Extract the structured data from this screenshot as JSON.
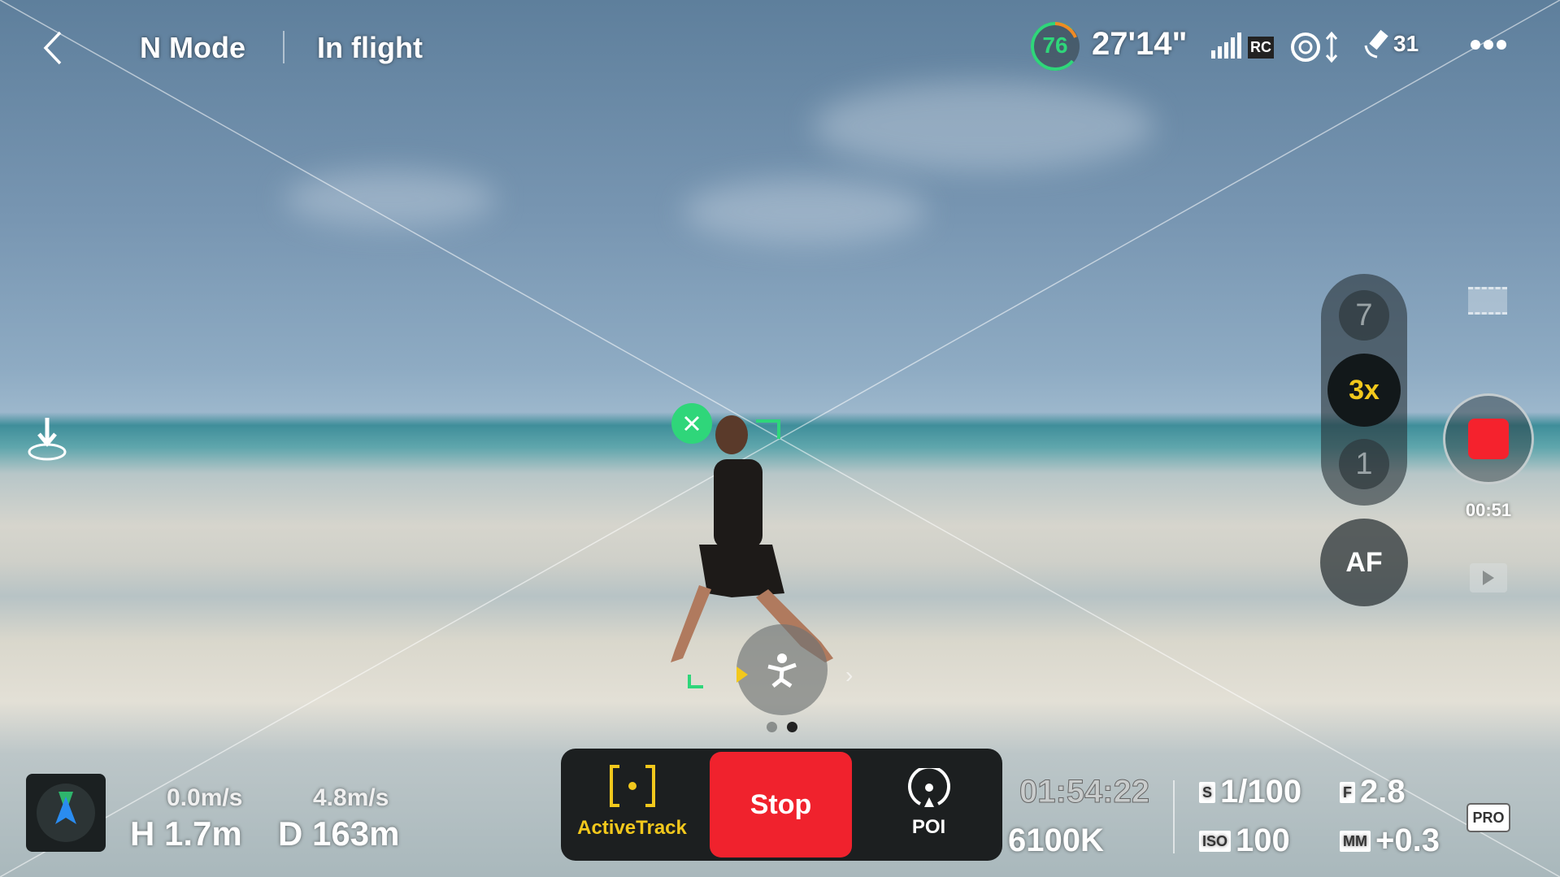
{
  "topbar": {
    "mode": "N Mode",
    "status": "In flight",
    "battery_percent": "76",
    "flight_time": "27'14\"",
    "rc_label": "RC",
    "satellites": "31"
  },
  "zoom": {
    "options": [
      "7",
      "3x",
      "1"
    ],
    "selected": "3x",
    "af_label": "AF"
  },
  "record": {
    "elapsed": "00:51"
  },
  "telemetry": {
    "vertical_speed": "0.0m/s",
    "horizontal_speed": "4.8m/s",
    "height": "H 1.7m",
    "distance": "D 163m"
  },
  "modes": {
    "activetrack": "ActiveTrack",
    "stop": "Stop",
    "poi": "POI"
  },
  "camera": {
    "remaining_time": "01:54:22",
    "white_balance": "6100K",
    "shutter_label": "S",
    "shutter": "1/100",
    "aperture_label": "F",
    "aperture": "2.8",
    "iso_label": "ISO",
    "iso": "100",
    "ev_label": "MM",
    "ev": "+0.3",
    "mode_label": "PRO"
  },
  "colors": {
    "accent_yellow": "#f2c81c",
    "stop_red": "#f0222d",
    "track_green": "#2fd67a",
    "record_red": "#f5222d"
  }
}
